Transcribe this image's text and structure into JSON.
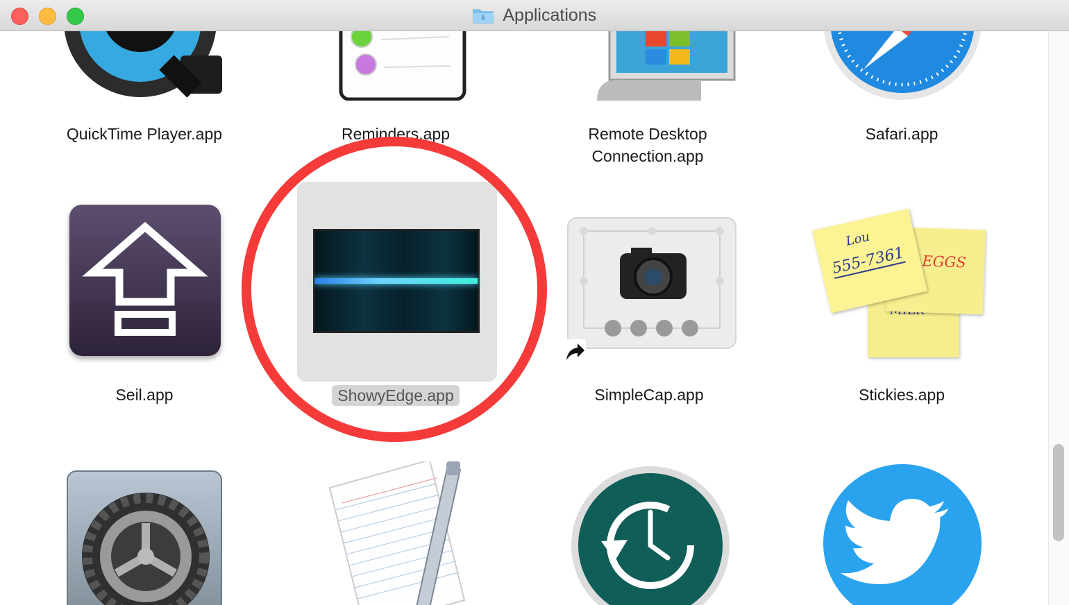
{
  "window": {
    "title": "Applications"
  },
  "apps": [
    {
      "label": "QuickTime Player.app"
    },
    {
      "label": "Reminders.app"
    },
    {
      "label_lines": [
        "Remote Desktop",
        "Connection.app"
      ]
    },
    {
      "label": "Safari.app"
    },
    {
      "label": "Seil.app"
    },
    {
      "label": "ShowyEdge.app",
      "selected": true
    },
    {
      "label": "SimpleCap.app",
      "alias": true
    },
    {
      "label": "Stickies.app"
    },
    {
      "label": ""
    },
    {
      "label": ""
    },
    {
      "label": ""
    },
    {
      "label": ""
    }
  ],
  "stickies_notes": {
    "note1_line1": "Lou",
    "note1_line2": "555-7361",
    "note2": "EGGS",
    "note3": "MILK"
  },
  "colors": {
    "callout": "#f53a3a",
    "selection": "#d4d4d4",
    "twitter": "#2aa3ef",
    "time_machine": "#0f5e57"
  }
}
